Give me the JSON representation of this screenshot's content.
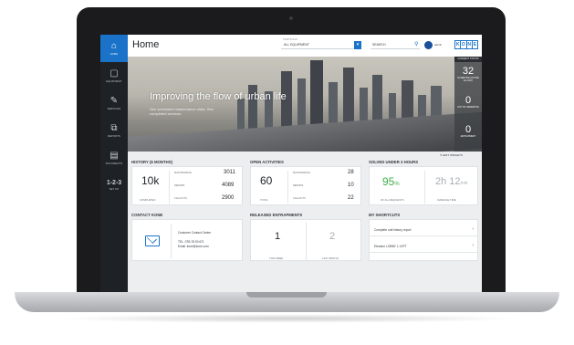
{
  "sidebar": {
    "items": [
      {
        "label": "HOME",
        "icon": "home-icon",
        "glyph": "⌂"
      },
      {
        "label": "EQUIPMENT",
        "icon": "equipment-icon",
        "glyph": "▢"
      },
      {
        "label": "SERVICES",
        "icon": "wrench-icon",
        "glyph": "✎"
      },
      {
        "label": "REPORTS",
        "icon": "report-icon",
        "glyph": "⧉"
      },
      {
        "label": "DOCUMENTS",
        "icon": "document-icon",
        "glyph": "▤"
      },
      {
        "label": "SET UP",
        "icon": "setup-icon",
        "glyph": "1-2-3"
      }
    ]
  },
  "header": {
    "title": "Home",
    "portfolio_label": "PORTFOLIO",
    "portfolio_value": "ALL EQUIPMENT",
    "search_placeholder": "SEARCH",
    "user": "admin",
    "logo_letters": [
      "K",
      "O",
      "N",
      "E"
    ]
  },
  "hero": {
    "headline": "Improving the flow of urban life",
    "sub": "See scheduled maintenance visits. See completed services.",
    "stats_header": "CURRENT STATUS",
    "stats": [
      {
        "value": "32",
        "label": "IN SERVICE (ACTIVE ALL DAY)"
      },
      {
        "value": "0",
        "label": "OUT OF OPERATION"
      },
      {
        "value": "0",
        "label": "ENTRAPMENT"
      }
    ]
  },
  "edit_widgets": "EDIT WIDGETS",
  "history": {
    "title": "HISTORY (6 MONTHS)",
    "completed_value": "10k",
    "completed_label": "COMPLETED",
    "rows": [
      {
        "label": "MAINTENANCE",
        "value": "3011"
      },
      {
        "label": "REPAIRS",
        "value": "4089"
      },
      {
        "label": "CALLOUTS",
        "value": "2900"
      }
    ]
  },
  "open": {
    "title": "OPEN ACTIVITIES",
    "total_value": "60",
    "total_label": "TOTAL",
    "rows": [
      {
        "label": "MAINTENANCE",
        "value": "28"
      },
      {
        "label": "REPAIRS",
        "value": "10"
      },
      {
        "label": "CALLOUTS",
        "value": "22"
      }
    ]
  },
  "solved": {
    "title": "SOLVED UNDER 3 HOURS",
    "percent_value": "95",
    "percent_unit": "%",
    "percent_label": "OF ALL REQUESTS",
    "avg_value": "2h 12",
    "avg_unit": "min",
    "avg_label": "AVERAGE TIME"
  },
  "contact": {
    "title": "CONTACT KONE",
    "center": "Customer Contact Center",
    "tel": "TEL. 0TB-78 90 671",
    "email": "Email: kone@kone.com"
  },
  "released": {
    "title": "RELEASED ENTRAPMENTS",
    "left_value": "1",
    "left_label": "THIS WEEK",
    "right_value": "2",
    "right_label": "LAST MONTH"
  },
  "shortcuts": {
    "title": "MY SHORTCUTS",
    "items": [
      "Complete unit history report",
      "Elevator LOBBY 1 LEFT"
    ]
  }
}
